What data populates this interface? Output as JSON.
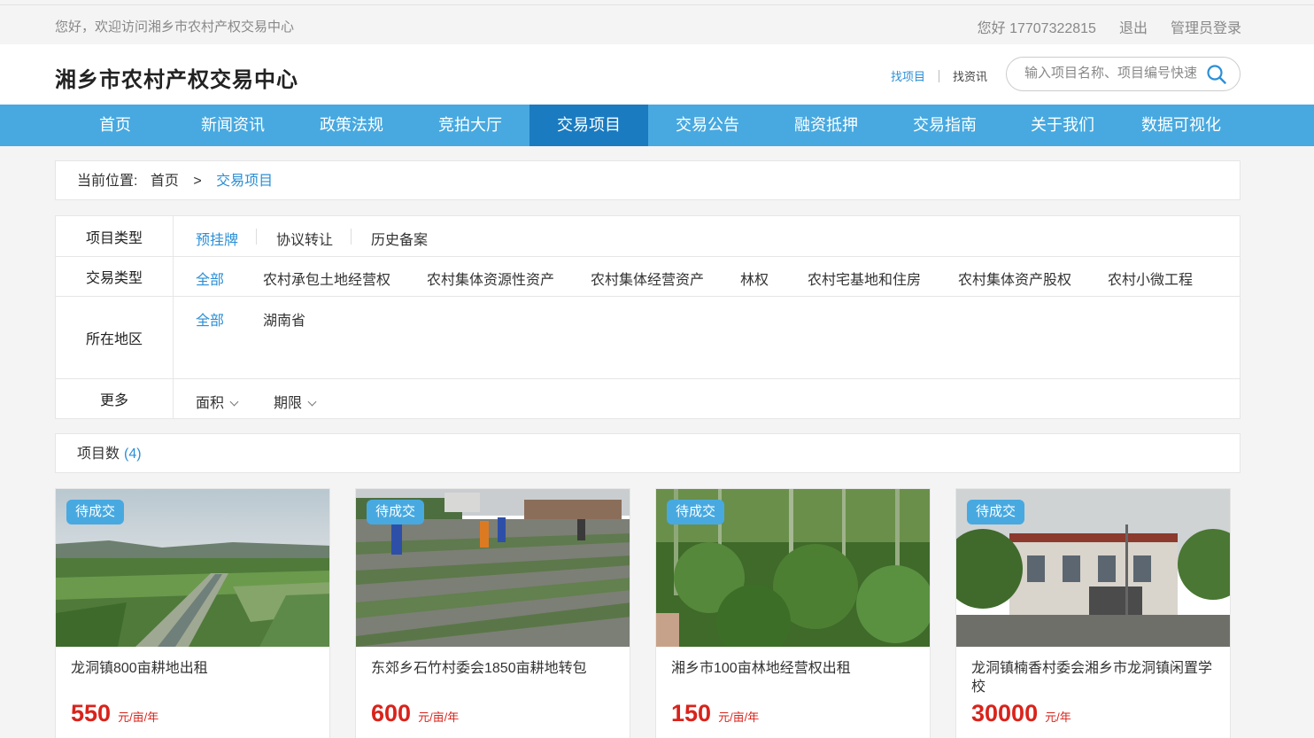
{
  "topbar": {
    "welcome": "您好，欢迎访问湘乡市农村产权交易中心",
    "user": "您好 17707322815",
    "logout": "退出",
    "admin": "管理员登录"
  },
  "header": {
    "logo": "湘乡市农村产权交易中心",
    "find_project": "找项目",
    "find_news": "找资讯",
    "search_placeholder": "输入项目名称、项目编号快速"
  },
  "nav": {
    "items": [
      {
        "label": "首页"
      },
      {
        "label": "新闻资讯"
      },
      {
        "label": "政策法规"
      },
      {
        "label": "竞拍大厅"
      },
      {
        "label": "交易项目"
      },
      {
        "label": "交易公告"
      },
      {
        "label": "融资抵押"
      },
      {
        "label": "交易指南"
      },
      {
        "label": "关于我们"
      },
      {
        "label": "数据可视化"
      }
    ],
    "active_index": 4
  },
  "breadcrumb": {
    "prefix": "当前位置:",
    "home": "首页",
    "sep": ">",
    "current": "交易项目"
  },
  "filters": {
    "project_type": {
      "label": "项目类型",
      "options": [
        "预挂牌",
        "协议转让",
        "历史备案"
      ]
    },
    "trade_type": {
      "label": "交易类型",
      "options": [
        "全部",
        "农村承包土地经营权",
        "农村集体资源性资产",
        "农村集体经营资产",
        "林权",
        "农村宅基地和住房",
        "农村集体资产股权",
        "农村小微工程"
      ]
    },
    "region": {
      "label": "所在地区",
      "options": [
        "全部",
        "湖南省"
      ]
    },
    "more": {
      "label": "更多",
      "options": [
        "面积",
        "期限"
      ]
    }
  },
  "count": {
    "label": "项目数",
    "value": "(4)"
  },
  "projects": [
    {
      "badge": "待成交",
      "title": "龙洞镇800亩耕地出租",
      "price": "550",
      "unit": "元/亩/年"
    },
    {
      "badge": "待成交",
      "title": "东郊乡石竹村委会1850亩耕地转包",
      "price": "600",
      "unit": "元/亩/年"
    },
    {
      "badge": "待成交",
      "title": "湘乡市100亩林地经营权出租",
      "price": "150",
      "unit": "元/亩/年"
    },
    {
      "badge": "待成交",
      "title": "龙洞镇楠香村委会湘乡市龙洞镇闲置学校",
      "price": "30000",
      "unit": "元/年"
    }
  ],
  "colors": {
    "nav_bg": "#47a9e0",
    "nav_active": "#1a7bc0",
    "link": "#2b8fd6",
    "price": "#d9231b"
  }
}
